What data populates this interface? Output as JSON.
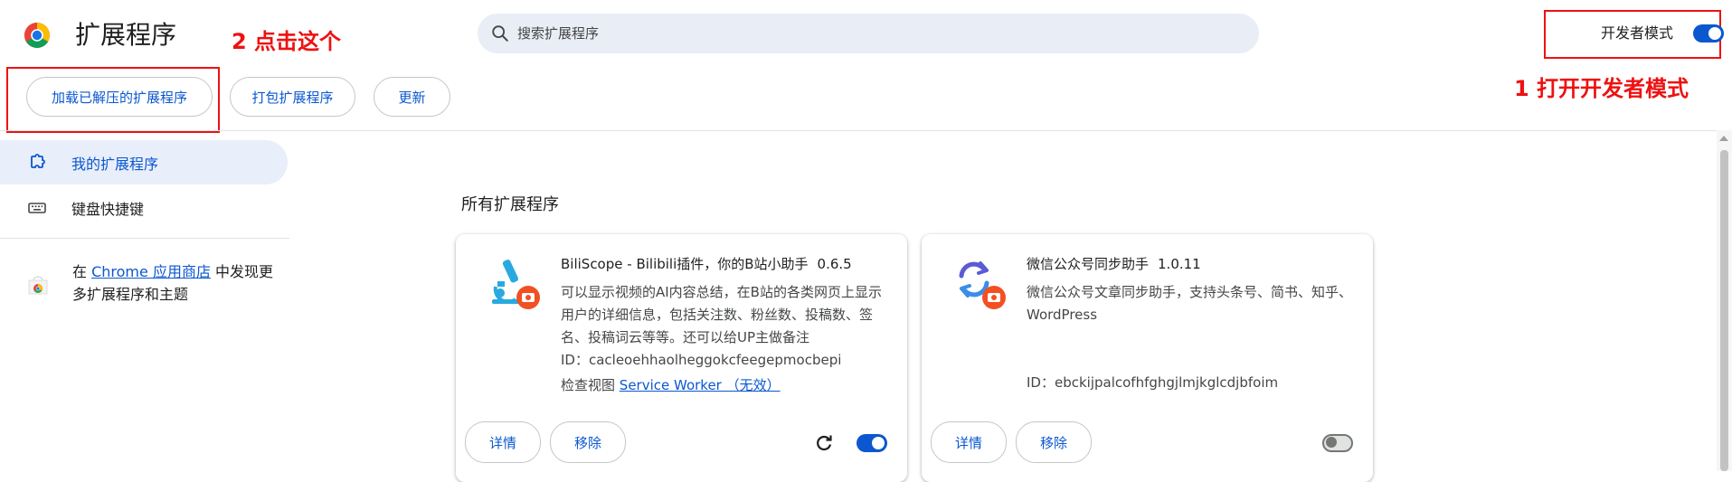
{
  "header": {
    "title": "扩展程序",
    "search_placeholder": "搜索扩展程序",
    "dev_mode_label": "开发者模式",
    "dev_mode_enabled": true
  },
  "annotations": {
    "step2": "2 点击这个",
    "step1": "1 打开开发者模式",
    "color": "#ee1111"
  },
  "toolbar": {
    "load_unpacked": "加载已解压的扩展程序",
    "pack": "打包扩展程序",
    "update": "更新"
  },
  "sidebar": {
    "my_extensions": "我的扩展程序",
    "keyboard_shortcuts": "键盘快捷键",
    "store_prefix": "在 ",
    "store_link": "Chrome 应用商店",
    "store_suffix": " 中发现更多扩展程序和主题"
  },
  "main": {
    "section_title": "所有扩展程序",
    "extensions": [
      {
        "name": "BiliScope - Bilibili插件，你的B站小助手",
        "version": "0.6.5",
        "description": "可以显示视频的AI内容总结，在B站的各类网页上显示用户的详细信息，包括关注数、粉丝数、投稿数、签名、投稿词云等等。还可以给UP主做备注",
        "id_line": "ID：cacleoehhaolheggokcfeegepmocbepi",
        "inspect_label": "检查视图",
        "inspect_link": "Service Worker （无效）",
        "details": "详情",
        "remove": "移除",
        "enabled": true
      },
      {
        "name": "微信公众号同步助手",
        "version": "1.0.11",
        "description": "微信公众号文章同步助手，支持头条号、简书、知乎、WordPress",
        "id_line": "ID：ebckijpalcofhfghgjlmjkglcdjbfoim",
        "details": "详情",
        "remove": "移除",
        "enabled": false
      }
    ]
  },
  "colors": {
    "accent": "#0b57d0",
    "search_bg": "#e9eef6",
    "active_nav_bg": "#e8eefa"
  }
}
